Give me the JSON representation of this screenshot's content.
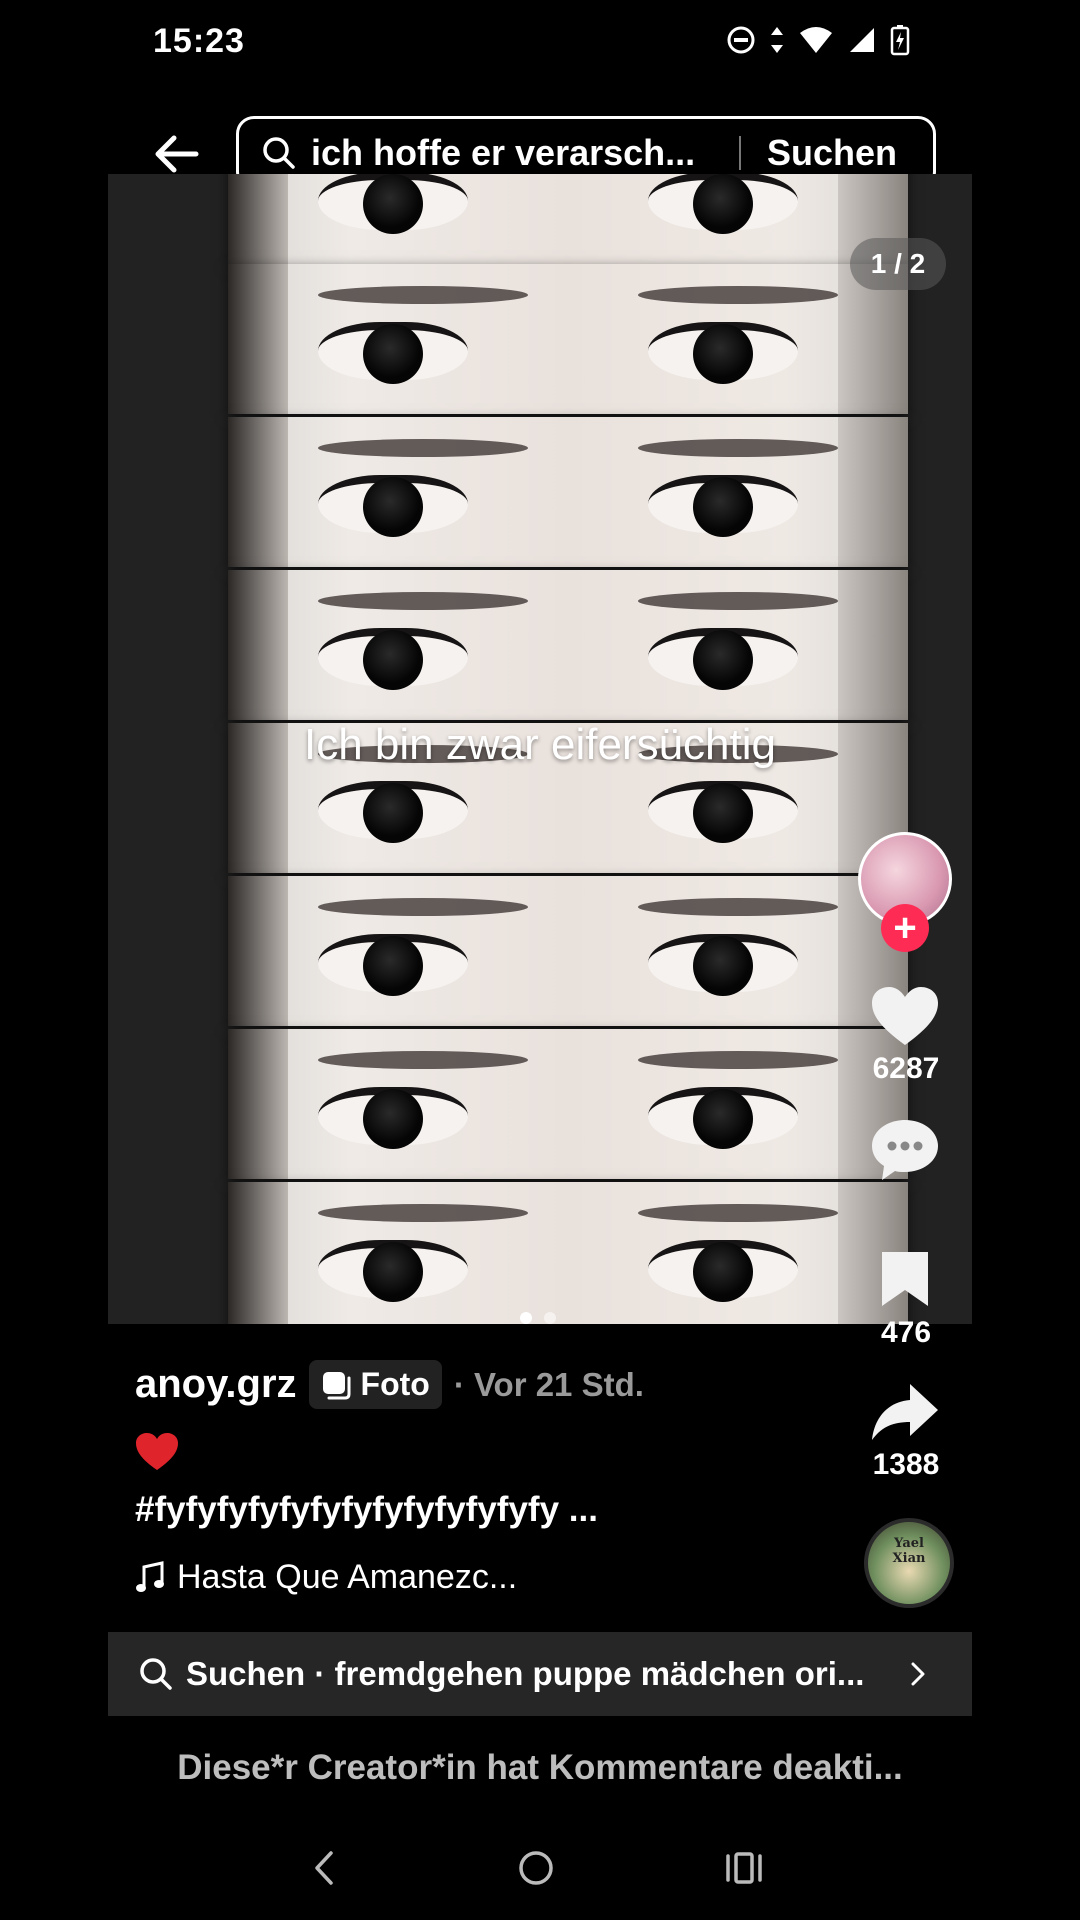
{
  "status_bar": {
    "time": "15:23",
    "icons": [
      "do-not-disturb-icon",
      "data-arrows-icon",
      "wifi-icon",
      "signal-icon",
      "battery-charging-icon"
    ]
  },
  "header": {
    "search_query": "ich hoffe er verarsch...",
    "search_button": "Suchen"
  },
  "post": {
    "page_counter": "1 / 2",
    "overlay_text": "Ich bin zwar eifersüchtig",
    "current_page": 1,
    "total_pages": 2
  },
  "rail": {
    "likes": "6287",
    "bookmarks": "476",
    "shares": "1388"
  },
  "meta": {
    "creator": "anoy.grz",
    "type_chip": "Foto",
    "timestamp": "· Vor 21 Std.",
    "caption_emoji": "❤️",
    "hashtags": "#fyfyfyfyfyfyfyfyfyfyfyfyfy ...",
    "music": "Hasta Que Amanezc...",
    "music_disc_text": "Yael Xian"
  },
  "related_search": {
    "label": "Suchen · fremdgehen puppe mädchen ori..."
  },
  "comments_notice": "Diese*r Creator*in hat Kommentare deakti...",
  "colors": {
    "accent": "#fe2c55",
    "background": "#000000",
    "search_bar": "#262626"
  }
}
